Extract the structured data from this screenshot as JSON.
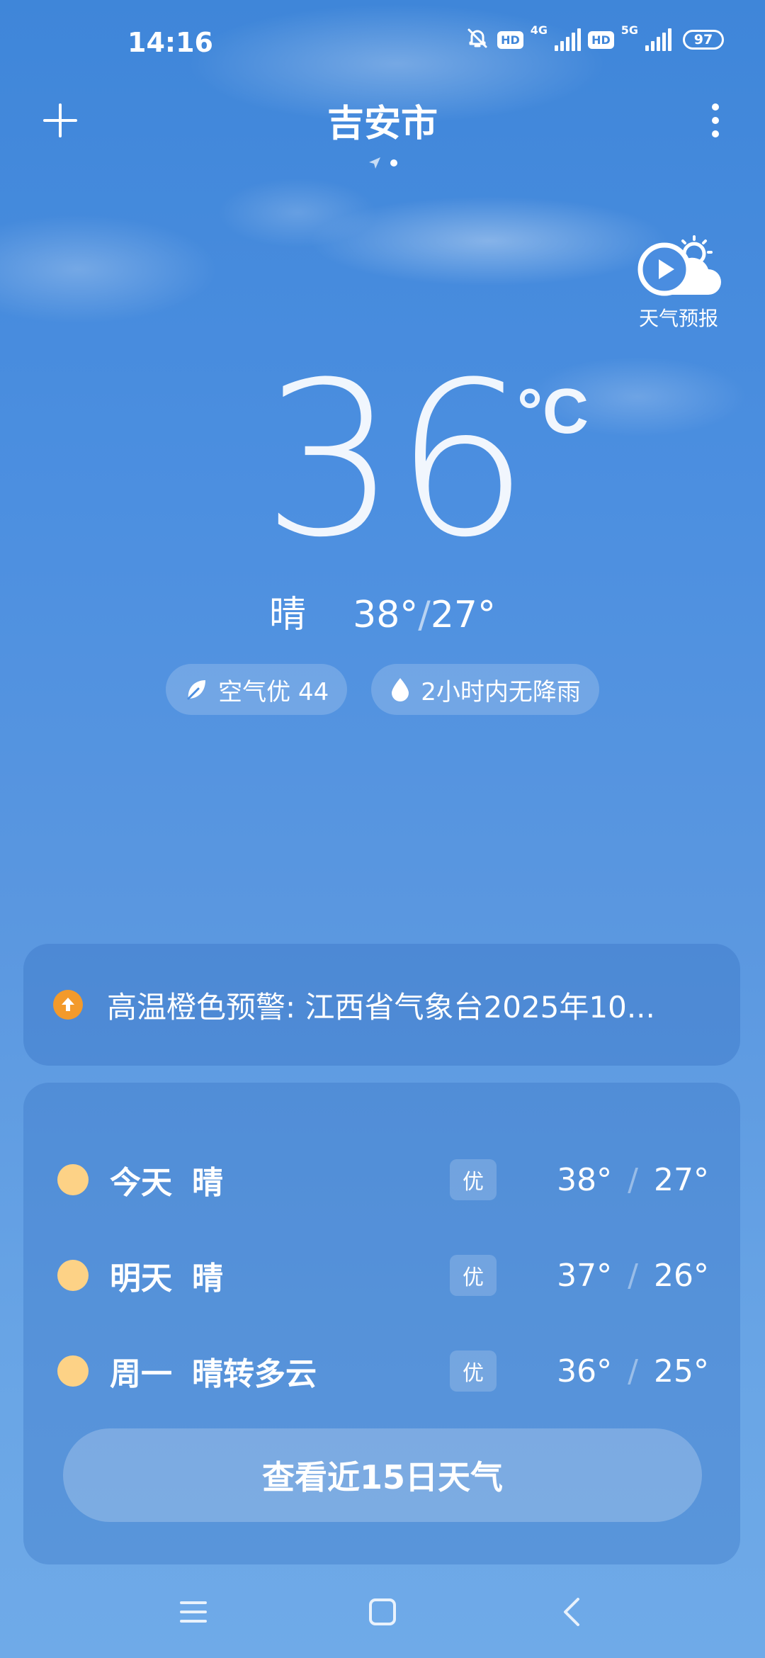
{
  "status_bar": {
    "time": "14:16",
    "hd1": "HD",
    "net1": "4G",
    "hd2": "HD",
    "net2": "5G",
    "battery": "97"
  },
  "header": {
    "city": "吉安市",
    "add_icon": "plus-icon",
    "more_icon": "more-vertical-icon"
  },
  "forecast_video": {
    "label": "天气预报",
    "icon": "play-sun-cloud-icon"
  },
  "current": {
    "temperature": "36",
    "unit": "°C",
    "condition": "晴",
    "high": "38°",
    "separator": "/",
    "low": "27°"
  },
  "pills": {
    "air_quality": "空气优 44",
    "rain": "2小时内无降雨"
  },
  "alert": {
    "text": "高温橙色预警: 江西省气象台2025年10..."
  },
  "daily": [
    {
      "day": "今天",
      "condition": "晴",
      "aq": "优",
      "high": "38°",
      "low": "27°"
    },
    {
      "day": "明天",
      "condition": "晴",
      "aq": "优",
      "high": "37°",
      "low": "26°"
    },
    {
      "day": "周一",
      "condition": "晴转多云",
      "aq": "优",
      "high": "36°",
      "low": "25°"
    }
  ],
  "daily_separator": "/",
  "view_15_days": "查看近15日天气",
  "colors": {
    "accent_orange": "#f39a2b",
    "sun": "#fdd286",
    "bg_top": "#3f86d9",
    "bg_bottom": "#6faae8"
  }
}
